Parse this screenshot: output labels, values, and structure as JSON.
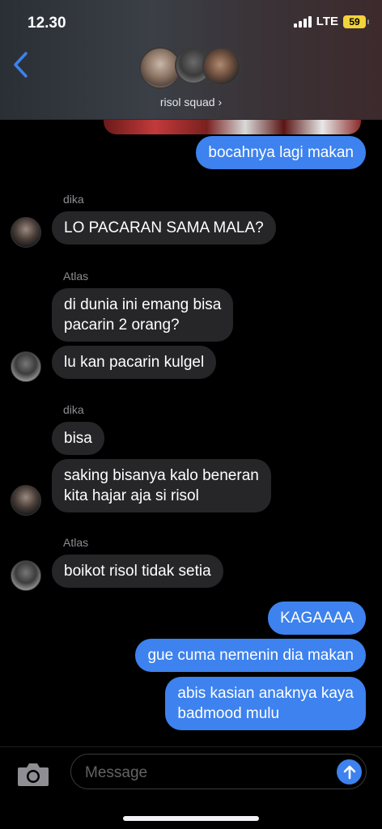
{
  "status_bar": {
    "time": "12.30",
    "network": "LTE",
    "battery": "59"
  },
  "header": {
    "group_name": "risol squad ›"
  },
  "messages": {
    "m1": "bocahnya lagi makan",
    "s1": "dika",
    "m2": "LO PACARAN SAMA MALA?",
    "s2": "Atlas",
    "m3": "di dunia ini emang bisa\npacarin 2 orang?",
    "m4": "lu kan pacarin kulgel",
    "s3": "dika",
    "m5": "bisa",
    "m6": "saking bisanya kalo beneran\nkita hajar aja si risol",
    "s4": "Atlas",
    "m7": "boikot risol tidak setia",
    "m8": "KAGAAAA",
    "m9": "gue cuma nemenin dia makan",
    "m10": "abis kasian anaknya kaya\nbadmood mulu"
  },
  "composer": {
    "placeholder": "Message"
  },
  "colors": {
    "outgoing": "#3d82ee",
    "incoming": "#262628",
    "battery": "#f2d33a"
  }
}
